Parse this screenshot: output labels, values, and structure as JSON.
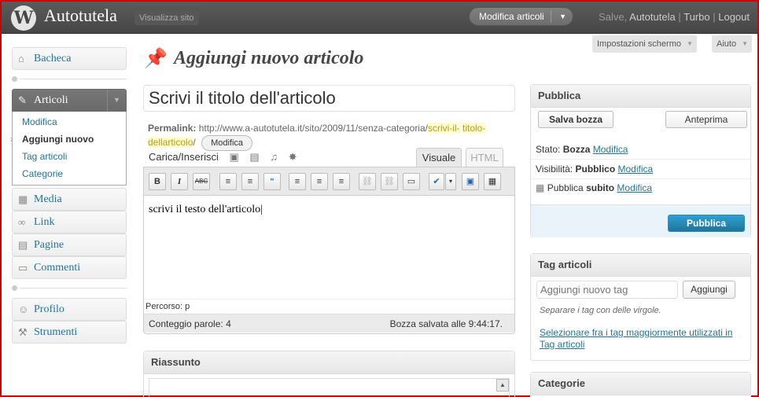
{
  "header": {
    "logo_letter": "W",
    "site_title": "Autotutela",
    "view_site": "Visualizza sito",
    "favorite_actions": "Modifica articoli",
    "greeting": "Salve,",
    "user": "Autotutela",
    "turbo": "Turbo",
    "logout": "Logout"
  },
  "screen_meta": {
    "options": "Impostazioni schermo",
    "help": "Aiuto"
  },
  "menu": {
    "dashboard": "Bacheca",
    "posts": "Articoli",
    "posts_sub": [
      "Modifica",
      "Aggiungi nuovo",
      "Tag articoli",
      "Categorie"
    ],
    "media": "Media",
    "links": "Link",
    "pages": "Pagine",
    "comments": "Commenti",
    "profile": "Profilo",
    "tools": "Strumenti"
  },
  "page": {
    "title": "Aggiungi nuovo articolo"
  },
  "post": {
    "title_value": "Scrivi il titolo dell'articolo",
    "permalink_label": "Permalink:",
    "permalink_base": "http://www.a-autotutela.it/sito/2009/11/senza-categoria/",
    "permalink_slug_1": "scrivi-il-",
    "permalink_slug_2": "titolo-dellarticolo",
    "permalink_end": "/",
    "permalink_edit": "Modifica",
    "upload_label": "Carica/Inserisci",
    "tab_visual": "Visuale",
    "tab_html": "HTML",
    "body": "scrivi il testo dell'articolo",
    "path": "Percorso: p",
    "word_count": "Conteggio parole: 4",
    "draft_saved": "Bozza salvata alle 9:44:17."
  },
  "toolbar_buttons": [
    "B",
    "I",
    "ABC",
    "≡",
    "≡",
    "“",
    "≡",
    "≡",
    "≡",
    "⛓",
    "⛓",
    "▭",
    "✔",
    "▾",
    "▣",
    "▦"
  ],
  "excerpt": {
    "title": "Riassunto"
  },
  "publish": {
    "title": "Pubblica",
    "save_draft": "Salva bozza",
    "preview": "Anteprima",
    "status_label": "Stato:",
    "status_value": "Bozza",
    "status_edit": "Modifica",
    "visibility_label": "Visibilità:",
    "visibility_value": "Pubblico",
    "visibility_edit": "Modifica",
    "schedule_label": "Pubblica",
    "schedule_value": "subito",
    "schedule_edit": "Modifica",
    "publish_button": "Pubblica"
  },
  "tags": {
    "title": "Tag articoli",
    "input_placeholder": "Aggiungi nuovo tag",
    "add_button": "Aggiungi",
    "hint": "Separare i tag con delle virgole.",
    "popular_link": "Selezionare fra i tag maggiormente utilizzati in Tag articoli"
  },
  "categories": {
    "title": "Categorie"
  },
  "colors": {
    "accent": "#21759b",
    "header": "#464646",
    "highlight": "#fffbcc"
  }
}
